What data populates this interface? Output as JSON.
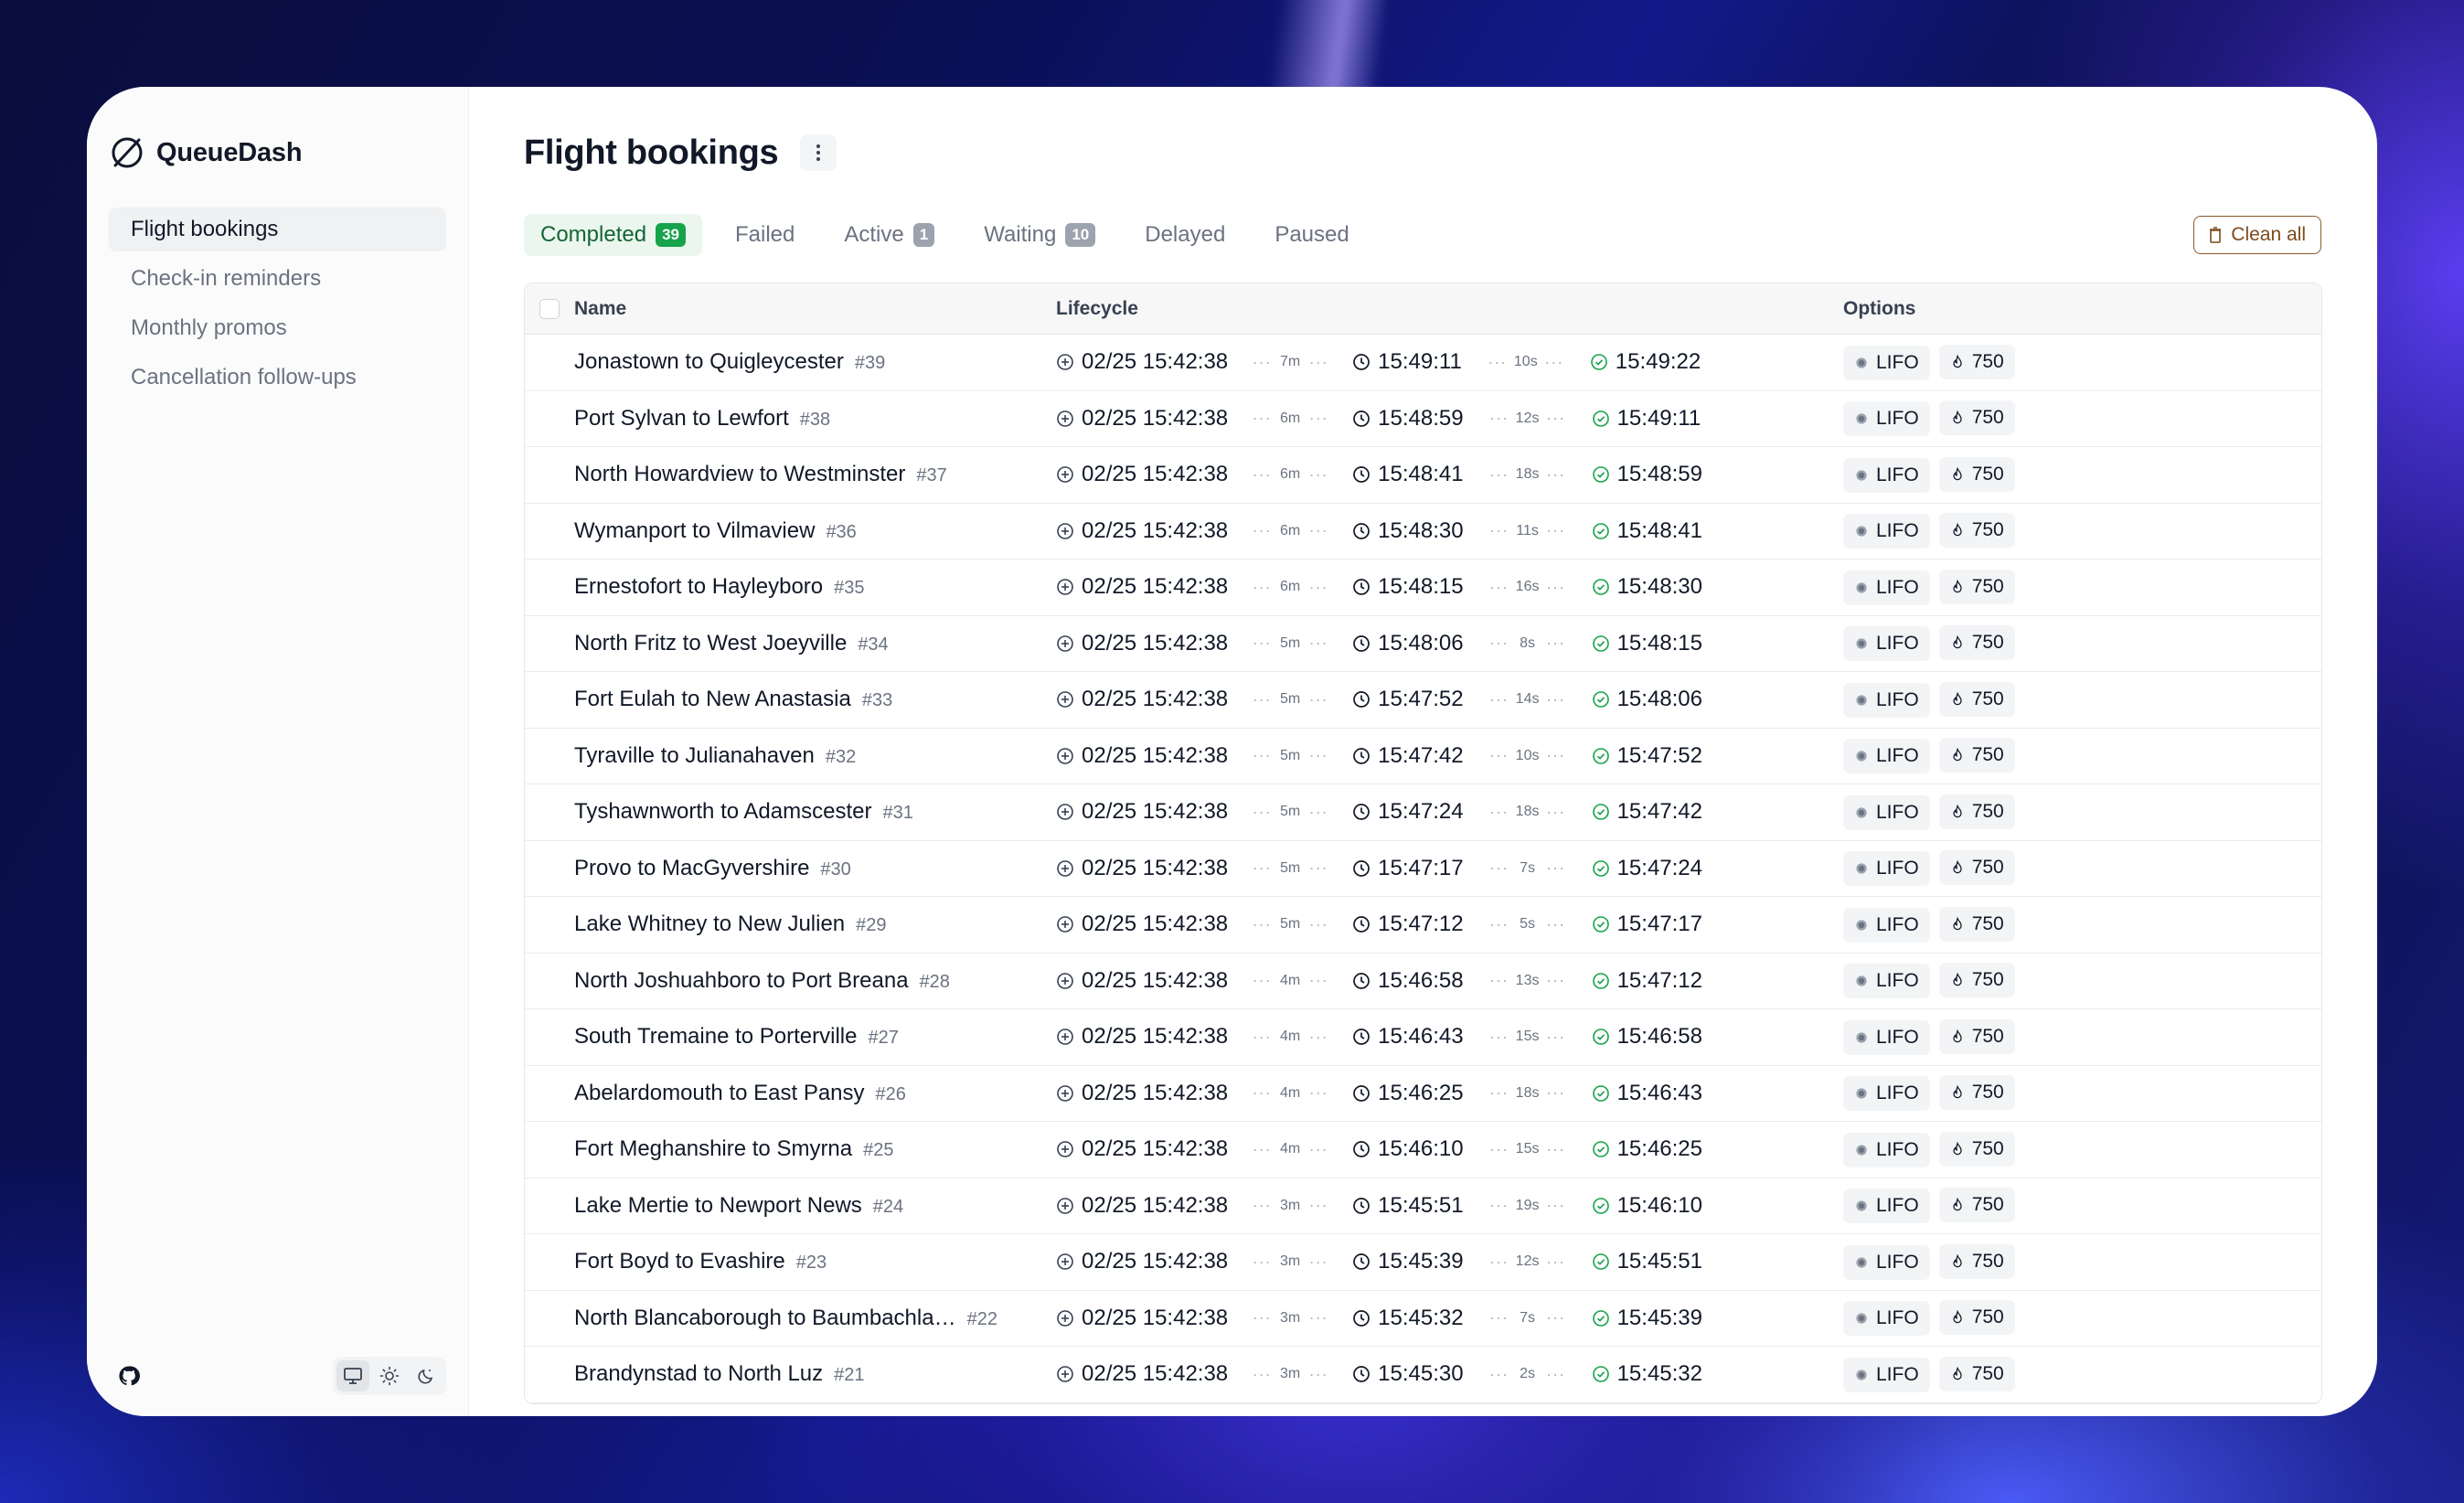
{
  "app": {
    "name": "QueueDash"
  },
  "sidebar": {
    "items": [
      {
        "label": "Flight bookings",
        "active": true
      },
      {
        "label": "Check-in reminders",
        "active": false
      },
      {
        "label": "Monthly promos",
        "active": false
      },
      {
        "label": "Cancellation follow-ups",
        "active": false
      }
    ],
    "footer": {
      "github_icon": "github-icon",
      "themes": [
        "monitor-icon",
        "sun-icon",
        "moon-icon"
      ],
      "selected_theme": "monitor-icon"
    }
  },
  "page": {
    "title": "Flight bookings"
  },
  "tabs": [
    {
      "label": "Completed",
      "count": "39",
      "active": true
    },
    {
      "label": "Failed",
      "count": null,
      "active": false
    },
    {
      "label": "Active",
      "count": "1",
      "active": false
    },
    {
      "label": "Waiting",
      "count": "10",
      "active": false
    },
    {
      "label": "Delayed",
      "count": null,
      "active": false
    },
    {
      "label": "Paused",
      "count": null,
      "active": false
    }
  ],
  "clean_button": {
    "label": "Clean all"
  },
  "table": {
    "headers": {
      "name": "Name",
      "lifecycle": "Lifecycle",
      "options": "Options"
    },
    "rows": [
      {
        "name": "Jonastown to Quigleycester",
        "id": "#39",
        "added": "02/25 15:42:38",
        "wait": "7m",
        "started": "15:49:11",
        "run": "10s",
        "finished": "15:49:22",
        "order": "LIFO",
        "priority": "750"
      },
      {
        "name": "Port Sylvan to Lewfort",
        "id": "#38",
        "added": "02/25 15:42:38",
        "wait": "6m",
        "started": "15:48:59",
        "run": "12s",
        "finished": "15:49:11",
        "order": "LIFO",
        "priority": "750"
      },
      {
        "name": "North Howardview to Westminster",
        "id": "#37",
        "added": "02/25 15:42:38",
        "wait": "6m",
        "started": "15:48:41",
        "run": "18s",
        "finished": "15:48:59",
        "order": "LIFO",
        "priority": "750"
      },
      {
        "name": "Wymanport to Vilmaview",
        "id": "#36",
        "added": "02/25 15:42:38",
        "wait": "6m",
        "started": "15:48:30",
        "run": "11s",
        "finished": "15:48:41",
        "order": "LIFO",
        "priority": "750"
      },
      {
        "name": "Ernestofort to Hayleyboro",
        "id": "#35",
        "added": "02/25 15:42:38",
        "wait": "6m",
        "started": "15:48:15",
        "run": "16s",
        "finished": "15:48:30",
        "order": "LIFO",
        "priority": "750"
      },
      {
        "name": "North Fritz to West Joeyville",
        "id": "#34",
        "added": "02/25 15:42:38",
        "wait": "5m",
        "started": "15:48:06",
        "run": "8s",
        "finished": "15:48:15",
        "order": "LIFO",
        "priority": "750"
      },
      {
        "name": "Fort Eulah to New Anastasia",
        "id": "#33",
        "added": "02/25 15:42:38",
        "wait": "5m",
        "started": "15:47:52",
        "run": "14s",
        "finished": "15:48:06",
        "order": "LIFO",
        "priority": "750"
      },
      {
        "name": "Tyraville to Julianahaven",
        "id": "#32",
        "added": "02/25 15:42:38",
        "wait": "5m",
        "started": "15:47:42",
        "run": "10s",
        "finished": "15:47:52",
        "order": "LIFO",
        "priority": "750"
      },
      {
        "name": "Tyshawnworth to Adamscester",
        "id": "#31",
        "added": "02/25 15:42:38",
        "wait": "5m",
        "started": "15:47:24",
        "run": "18s",
        "finished": "15:47:42",
        "order": "LIFO",
        "priority": "750"
      },
      {
        "name": "Provo to MacGyvershire",
        "id": "#30",
        "added": "02/25 15:42:38",
        "wait": "5m",
        "started": "15:47:17",
        "run": "7s",
        "finished": "15:47:24",
        "order": "LIFO",
        "priority": "750"
      },
      {
        "name": "Lake Whitney to New Julien",
        "id": "#29",
        "added": "02/25 15:42:38",
        "wait": "5m",
        "started": "15:47:12",
        "run": "5s",
        "finished": "15:47:17",
        "order": "LIFO",
        "priority": "750"
      },
      {
        "name": "North Joshuahboro to Port Breana",
        "id": "#28",
        "added": "02/25 15:42:38",
        "wait": "4m",
        "started": "15:46:58",
        "run": "13s",
        "finished": "15:47:12",
        "order": "LIFO",
        "priority": "750"
      },
      {
        "name": "South Tremaine to Porterville",
        "id": "#27",
        "added": "02/25 15:42:38",
        "wait": "4m",
        "started": "15:46:43",
        "run": "15s",
        "finished": "15:46:58",
        "order": "LIFO",
        "priority": "750"
      },
      {
        "name": "Abelardomouth to East Pansy",
        "id": "#26",
        "added": "02/25 15:42:38",
        "wait": "4m",
        "started": "15:46:25",
        "run": "18s",
        "finished": "15:46:43",
        "order": "LIFO",
        "priority": "750"
      },
      {
        "name": "Fort Meghanshire to Smyrna",
        "id": "#25",
        "added": "02/25 15:42:38",
        "wait": "4m",
        "started": "15:46:10",
        "run": "15s",
        "finished": "15:46:25",
        "order": "LIFO",
        "priority": "750"
      },
      {
        "name": "Lake Mertie to Newport News",
        "id": "#24",
        "added": "02/25 15:42:38",
        "wait": "3m",
        "started": "15:45:51",
        "run": "19s",
        "finished": "15:46:10",
        "order": "LIFO",
        "priority": "750"
      },
      {
        "name": "Fort Boyd to Evashire",
        "id": "#23",
        "added": "02/25 15:42:38",
        "wait": "3m",
        "started": "15:45:39",
        "run": "12s",
        "finished": "15:45:51",
        "order": "LIFO",
        "priority": "750"
      },
      {
        "name": "North Blancaborough to Baumbachla…",
        "id": "#22",
        "added": "02/25 15:42:38",
        "wait": "3m",
        "started": "15:45:32",
        "run": "7s",
        "finished": "15:45:39",
        "order": "LIFO",
        "priority": "750"
      },
      {
        "name": "Brandynstad to North Luz",
        "id": "#21",
        "added": "02/25 15:42:38",
        "wait": "3m",
        "started": "15:45:30",
        "run": "2s",
        "finished": "15:45:32",
        "order": "LIFO",
        "priority": "750"
      }
    ]
  },
  "colors": {
    "accent_green": "#16a34a",
    "tab_active_bg": "#eaf6ee",
    "clean_border": "#8a5a2b"
  }
}
